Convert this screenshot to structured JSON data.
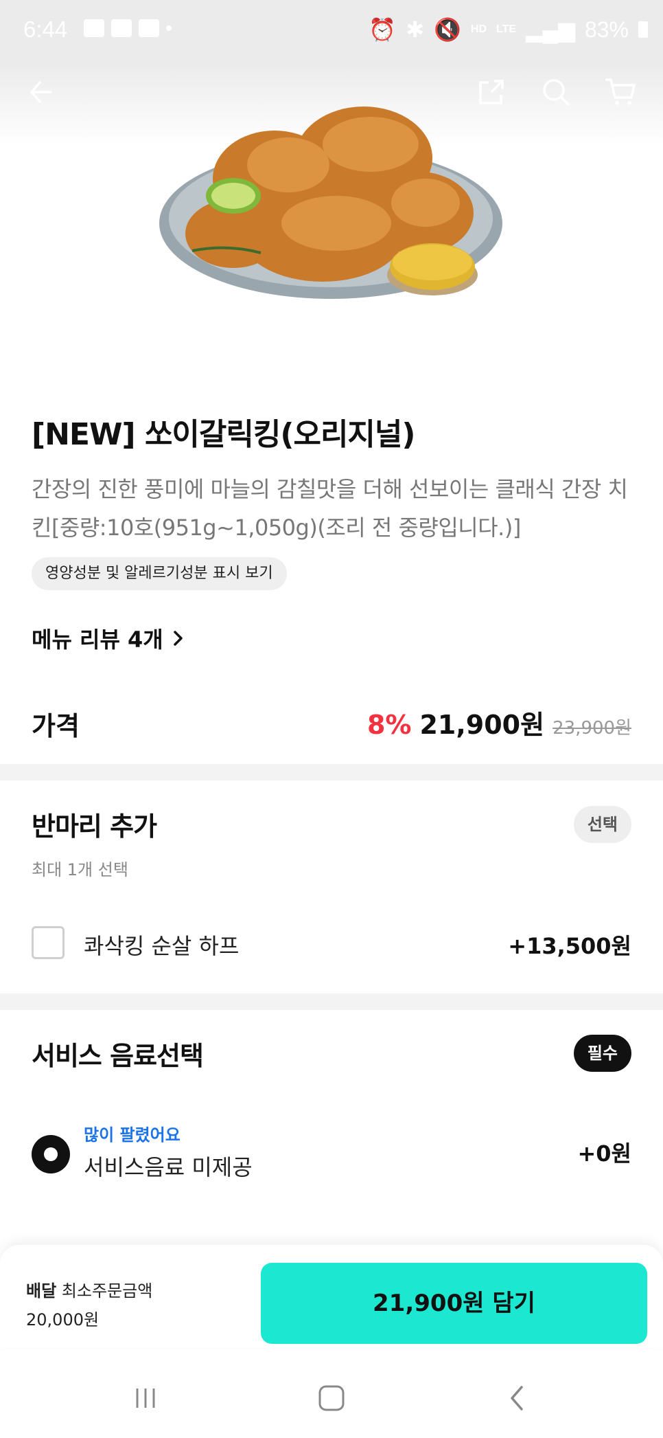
{
  "status_bar": {
    "time": "6:44",
    "battery": "83%",
    "hd_label": "HD",
    "lte_label": "LTE"
  },
  "top_bar": {
    "back_icon": "arrow-left-icon",
    "share_icon": "share-icon",
    "search_icon": "search-icon",
    "cart_icon": "cart-icon"
  },
  "product": {
    "title": "[NEW] 쏘이갈릭킹(오리지널)",
    "description": "간장의 진한 풍미에 마늘의 감칠맛을 더해 선보이는 클래식 간장 치킨[중량:10호(951g~1,050g)(조리 전 중량입니다.)]",
    "nutrition_chip": "영양성분 및 알레르기성분 표시 보기",
    "review_link": "메뉴 리뷰 4개"
  },
  "price": {
    "label": "가격",
    "discount": "8%",
    "current": "21,900원",
    "original": "23,900원"
  },
  "section_half": {
    "title": "반마리 추가",
    "subtitle": "최대 1개 선택",
    "badge": "선택",
    "options": [
      {
        "label": "콰삭킹 순살 하프",
        "price": "+13,500원",
        "checked": false
      }
    ]
  },
  "section_drink": {
    "title": "서비스 음료선택",
    "badge": "필수",
    "options": [
      {
        "tag": "많이 팔렸어요",
        "label": "서비스음료 미제공",
        "price": "+0원",
        "selected": true
      }
    ]
  },
  "footer": {
    "delivery_label": "배달",
    "min_order_label": "최소주문금액",
    "min_order_value": "20,000원",
    "cta": "21,900원 담기"
  },
  "colors": {
    "accent": "#1ce8d2",
    "discount": "#f2323f",
    "popular": "#1a73e8"
  }
}
